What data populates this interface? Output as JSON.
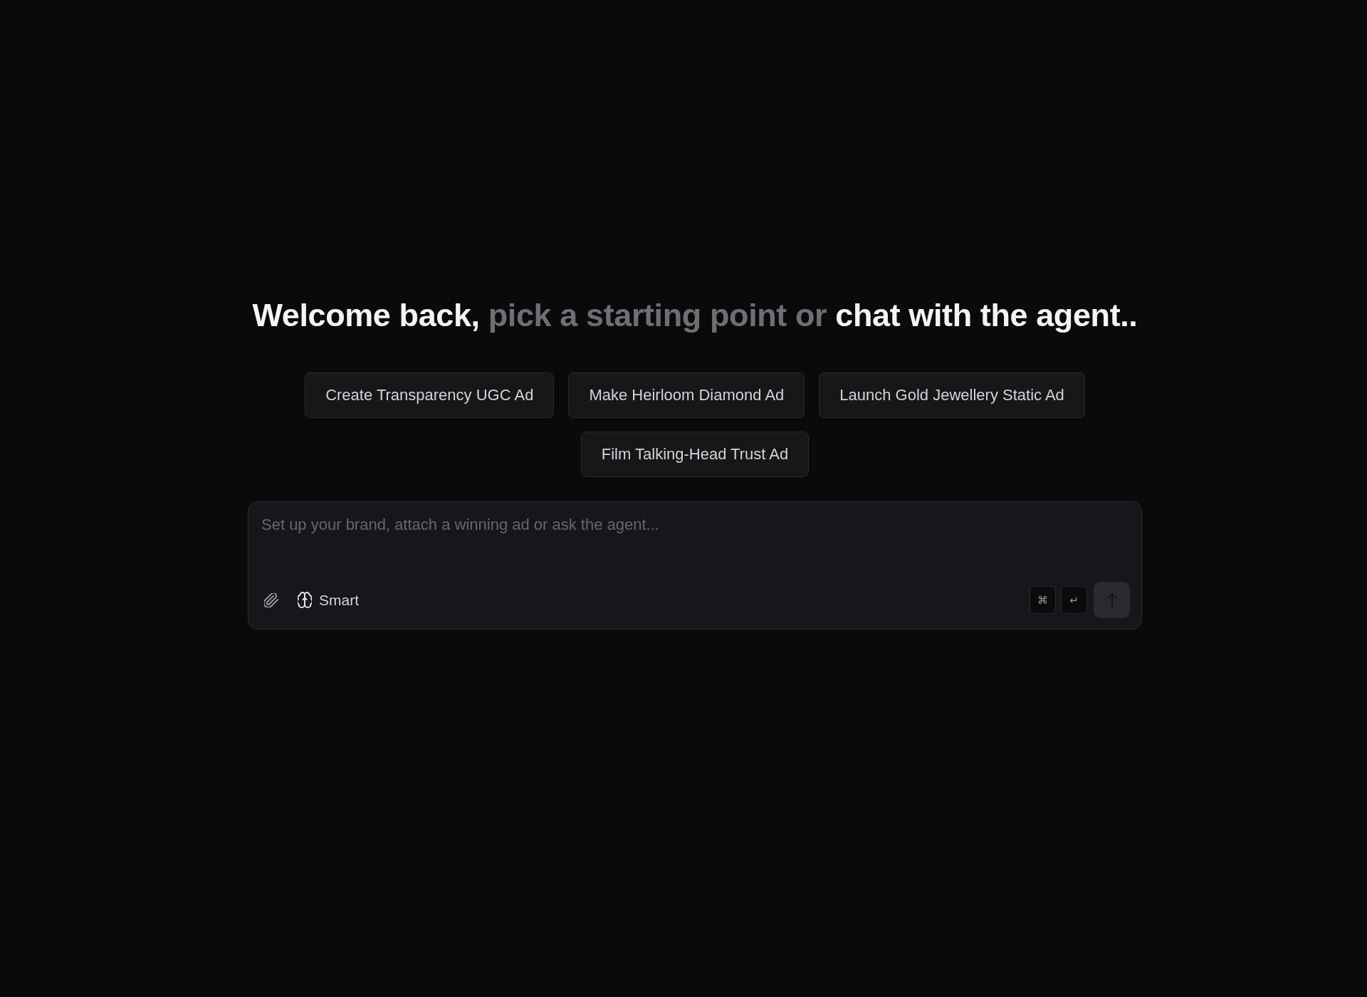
{
  "heading": {
    "parts": [
      {
        "text": "Welcome back,",
        "muted": false
      },
      {
        "text": "pick a starting point or",
        "muted": true
      },
      {
        "text": "chat with the agent..",
        "muted": false
      }
    ]
  },
  "suggestions": [
    {
      "label": "Create Transparency UGC Ad"
    },
    {
      "label": "Make Heirloom Diamond Ad"
    },
    {
      "label": "Launch Gold Jewellery Static Ad"
    },
    {
      "label": "Film Talking-Head Trust Ad"
    }
  ],
  "composer": {
    "placeholder": "Set up your brand, attach a winning ad or ask the agent...",
    "mode": {
      "label": "Smart"
    },
    "shortcut_keys": [
      "⌘",
      "↵"
    ],
    "send_button": {
      "disabled": true
    }
  }
}
